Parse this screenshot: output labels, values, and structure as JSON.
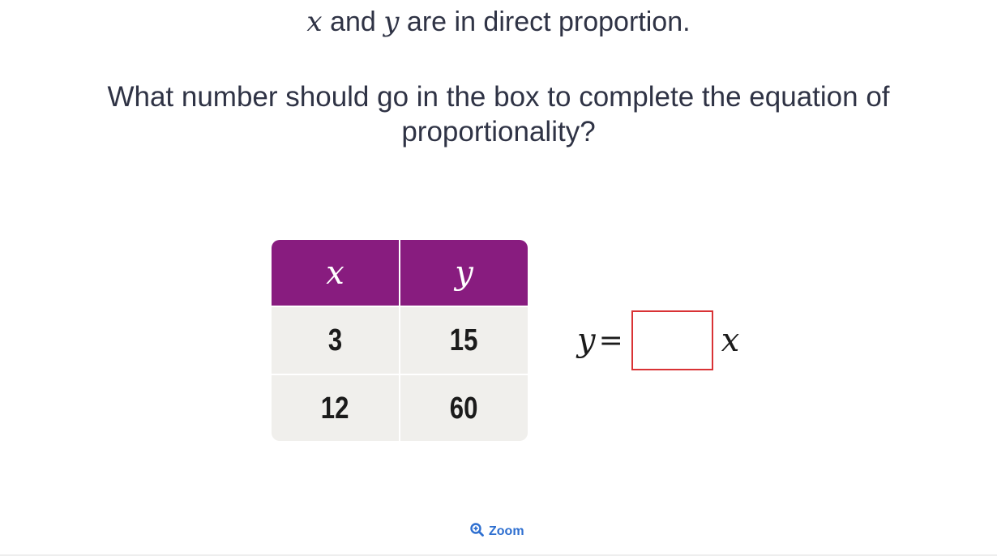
{
  "intro": {
    "var_x": "x",
    "connector": "and",
    "var_y": "y",
    "rest": "are in direct proportion."
  },
  "question": "What number should go in the box to complete the equation of proportionality?",
  "table": {
    "headers": [
      "x",
      "y"
    ],
    "rows": [
      [
        "3",
        "15"
      ],
      [
        "12",
        "60"
      ]
    ],
    "header_color": "#881c7f",
    "cell_color": "#f0efec"
  },
  "equation": {
    "lhs": "y",
    "equals": "=",
    "rhs": "x",
    "answer_value": ""
  },
  "zoom": {
    "icon": "zoom-in-icon",
    "label": "Zoom",
    "color": "#2e6fd0"
  }
}
